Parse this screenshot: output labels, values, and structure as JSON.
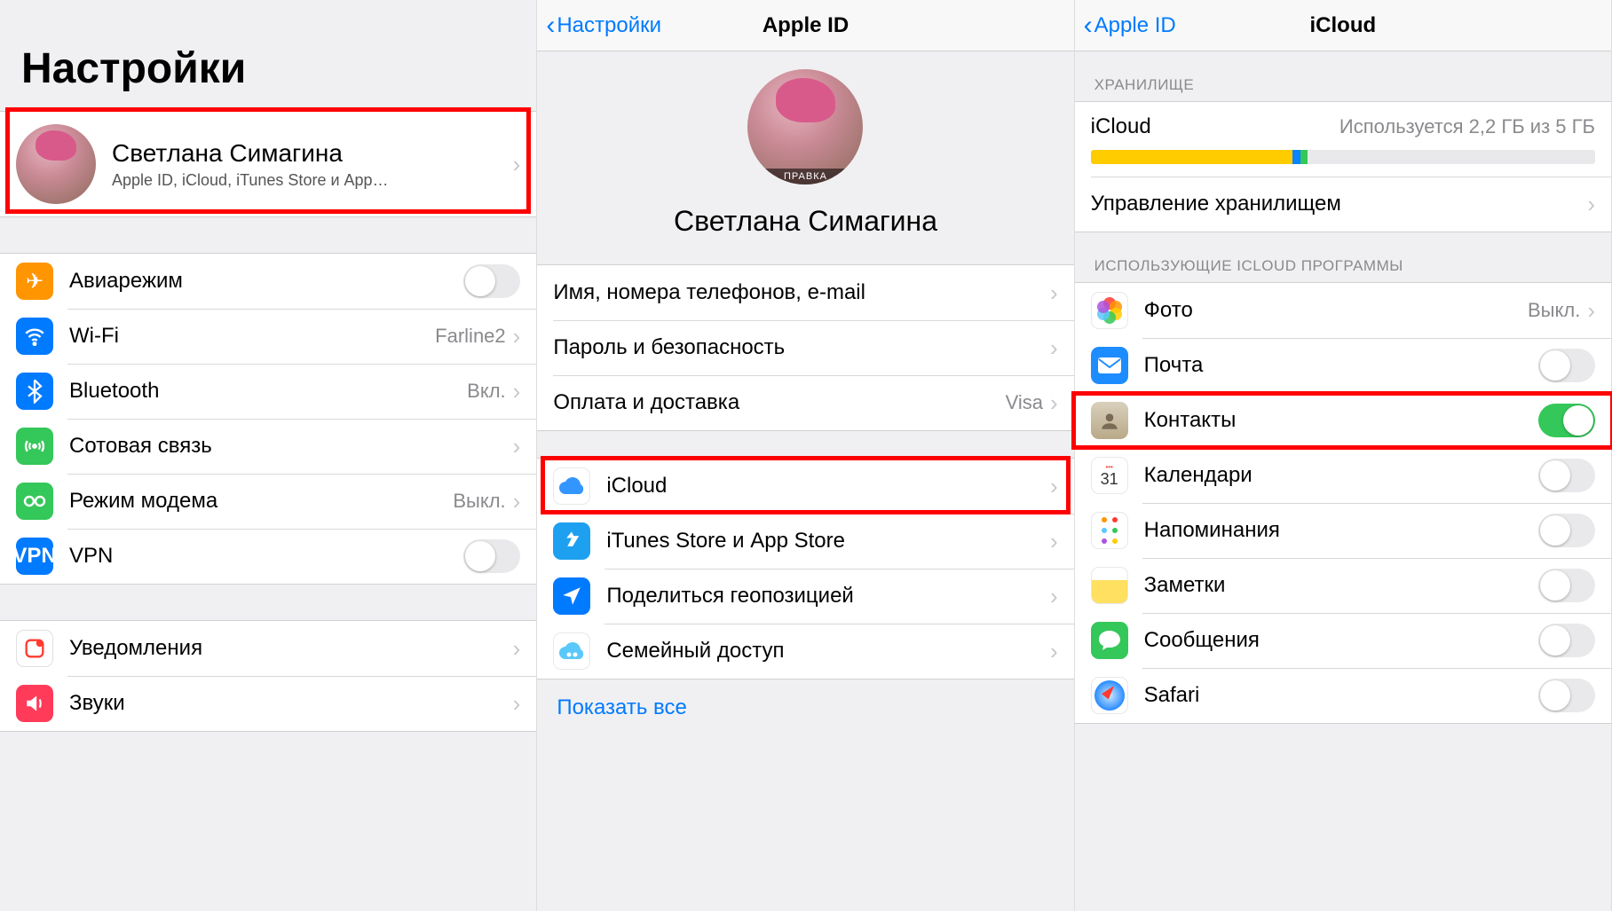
{
  "screen1": {
    "title": "Настройки",
    "profile": {
      "name": "Светлана Симагина",
      "subtitle": "Apple ID, iCloud, iTunes Store и App…"
    },
    "rows": {
      "airplane": "Авиарежим",
      "wifi": "Wi-Fi",
      "wifi_value": "Farline2",
      "bluetooth": "Bluetooth",
      "bluetooth_value": "Вкл.",
      "cellular": "Сотовая связь",
      "hotspot": "Режим модема",
      "hotspot_value": "Выкл.",
      "vpn": "VPN",
      "vpn_label": "VPN",
      "notifications": "Уведомления",
      "sounds": "Звуки"
    }
  },
  "screen2": {
    "back": "Настройки",
    "title": "Apple ID",
    "edit": "ПРАВКА",
    "name": "Светлана Симагина",
    "rows": {
      "name_phone": "Имя, номера телефонов, e-mail",
      "password": "Пароль и безопасность",
      "payment": "Оплата и доставка",
      "payment_value": "Visa",
      "icloud": "iCloud",
      "itunes": "iTunes Store и App Store",
      "find": "Поделиться геопозицией",
      "family": "Семейный доступ"
    },
    "show_all": "Показать все"
  },
  "screen3": {
    "back": "Apple ID",
    "title": "iCloud",
    "storage_header": "ХРАНИЛИЩЕ",
    "storage_label": "iCloud",
    "storage_value": "Используется 2,2 ГБ из 5 ГБ",
    "storage_segments": [
      {
        "color": "#ffcc00",
        "pct": 40
      },
      {
        "color": "#0a84ff",
        "pct": 1.5
      },
      {
        "color": "#34c759",
        "pct": 1.5
      },
      {
        "color": "#e9e9eb",
        "pct": 57
      }
    ],
    "manage": "Управление хранилищем",
    "apps_header": "ИСПОЛЬЗУЮЩИЕ ICLOUD ПРОГРАММЫ",
    "apps": {
      "photos": "Фото",
      "photos_value": "Выкл.",
      "mail": "Почта",
      "contacts": "Контакты",
      "calendar": "Календари",
      "reminders": "Напоминания",
      "notes": "Заметки",
      "messages": "Сообщения",
      "safari": "Safari"
    },
    "toggles": {
      "mail": false,
      "contacts": true,
      "calendar": false,
      "reminders": false,
      "notes": false,
      "messages": false,
      "safari": false
    }
  }
}
